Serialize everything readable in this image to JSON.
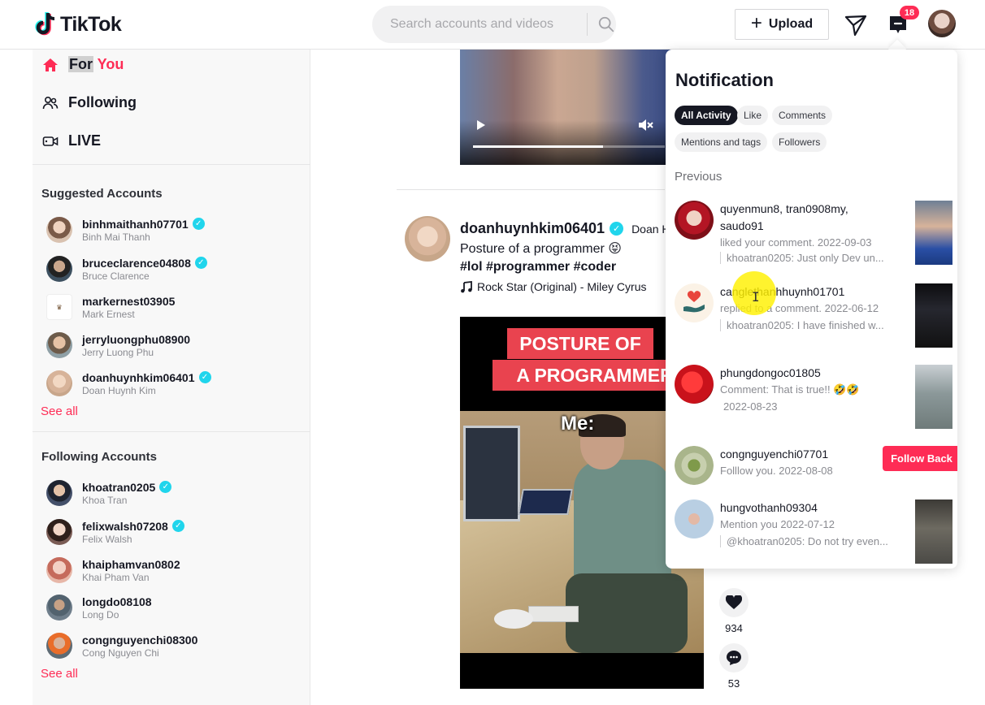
{
  "header": {
    "logo_text": "TikTok",
    "search_placeholder": "Search accounts and videos",
    "upload_label": "Upload",
    "inbox_badge": "18",
    "accent": "#fe2c55"
  },
  "sidebar": {
    "nav": [
      {
        "label_a": "For",
        "label_b": " You",
        "icon": "home-icon"
      },
      {
        "label": "Following",
        "icon": "people-icon"
      },
      {
        "label": "LIVE",
        "icon": "live-icon"
      }
    ],
    "suggested_title": "Suggested Accounts",
    "suggested": [
      {
        "username": "binhmaithanh07701",
        "name": "Binh Mai Thanh",
        "verified": true
      },
      {
        "username": "bruceclarence04808",
        "name": "Bruce Clarence",
        "verified": true
      },
      {
        "username": "markernest03905",
        "name": "Mark Ernest",
        "verified": false
      },
      {
        "username": "jerryluongphu08900",
        "name": "Jerry Luong Phu",
        "verified": false
      },
      {
        "username": "doanhuynhkim06401",
        "name": "Doan Huynh Kim",
        "verified": true
      }
    ],
    "following_title": "Following Accounts",
    "following": [
      {
        "username": "khoatran0205",
        "name": "Khoa Tran",
        "verified": true
      },
      {
        "username": "felixwalsh07208",
        "name": "Felix Walsh",
        "verified": true
      },
      {
        "username": "khaiphamvan0802",
        "name": "Khai Pham Van",
        "verified": false
      },
      {
        "username": "longdo08108",
        "name": "Long Do",
        "verified": false
      },
      {
        "username": "congnguyenchi08300",
        "name": "Cong Nguyen Chi",
        "verified": false
      }
    ],
    "see_all": "See all"
  },
  "feed": {
    "prev_video_progress": 0.68,
    "post": {
      "author": "doanhuynhkim06401",
      "nickname": "Doan H",
      "caption": "Posture of a programmer 😝",
      "tags": "#lol #programmer #coder",
      "music": "Rock Star (Original) - Miley Cyrus",
      "banner_line1": "POSTURE OF",
      "banner_line2": "A PROGRAMMER",
      "overlay_text": "Me:",
      "likes": "934",
      "comments": "53"
    }
  },
  "notifications": {
    "title": "Notification",
    "tabs": [
      "All Activity",
      "Like",
      "Comments",
      "Mentions and tags",
      "Followers"
    ],
    "active_tab": "All Activity",
    "section": "Previous",
    "items": [
      {
        "title": "quyenmun8, tran0908my, saudo91",
        "sub": "liked your comment. 2022-09-03",
        "quote": "khoatran0205: Just only Dev un..."
      },
      {
        "title": "canglethanhhuynh01701",
        "sub": "replied to a comment. 2022-06-12",
        "quote": "khoatran0205: I have finished w..."
      },
      {
        "title": "phungdongoc01805",
        "sub": "Comment: That is true!! 🤣🤣",
        "sub2": "2022-08-23"
      },
      {
        "title": "congnguyenchi07701",
        "sub": "Folllow you. 2022-08-08",
        "button": "Follow Back"
      },
      {
        "title": "hungvothanh09304",
        "sub": "Mention you 2022-07-12",
        "quote": "@khoatran0205: Do not try even..."
      }
    ]
  }
}
